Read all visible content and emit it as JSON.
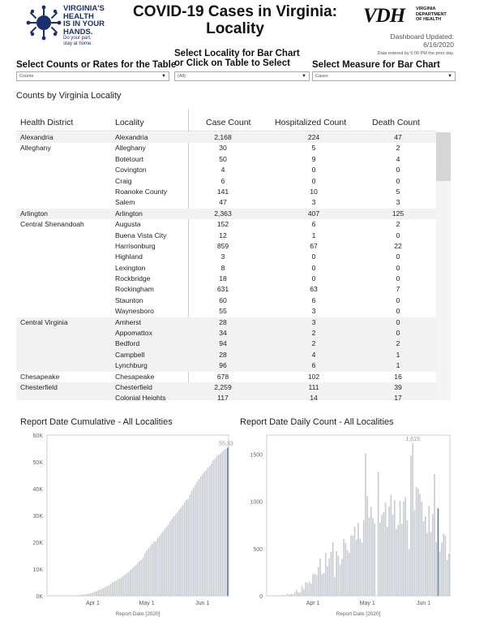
{
  "header": {
    "logo_lines": [
      "VIRGINIA'S",
      "HEALTH",
      "IS IN YOUR",
      "HANDS."
    ],
    "logo_sub": [
      "Do your part,",
      "stay at home."
    ],
    "title_line1": "COVID-19 Cases in Virginia:",
    "title_line2": "Locality",
    "vdh_mark": "VDH",
    "vdh_sub": [
      "VIRGINIA",
      "DEPARTMENT",
      "OF HEALTH"
    ],
    "updated_label": "Dashboard Updated:",
    "updated_date": "6/16/2020",
    "updated_note": "Data entered by 5:00 PM the prior day."
  },
  "filters": {
    "counts_label": "Select Counts or Rates for the Table",
    "counts_value": "Counts",
    "locality_label_1": "Select Locality for Bar Chart",
    "locality_label_2": "or Click on Table to Select",
    "locality_value": "(All)",
    "measure_label": "Select Measure for Bar Chart",
    "measure_value": "Cases",
    "dropdown_arrow": "▼"
  },
  "table": {
    "title": "Counts by Virginia Locality",
    "columns": [
      "Health District",
      "Locality",
      "Case Count",
      "Hospitalized Count",
      "Death Count"
    ],
    "rows": [
      [
        "Alexandria",
        "Alexandria",
        "2,168",
        "224",
        "47"
      ],
      [
        "Alleghany",
        "Alleghany",
        "30",
        "5",
        "2"
      ],
      [
        "",
        "Botetourt",
        "50",
        "9",
        "4"
      ],
      [
        "",
        "Covington",
        "4",
        "0",
        "0"
      ],
      [
        "",
        "Craig",
        "6",
        "0",
        "0"
      ],
      [
        "",
        "Roanoke County",
        "141",
        "10",
        "5"
      ],
      [
        "",
        "Salem",
        "47",
        "3",
        "3"
      ],
      [
        "Arlington",
        "Arlington",
        "2,363",
        "407",
        "125"
      ],
      [
        "Central Shenandoah",
        "Augusta",
        "152",
        "6",
        "2"
      ],
      [
        "",
        "Buena Vista City",
        "12",
        "1",
        "0"
      ],
      [
        "",
        "Harrisonburg",
        "859",
        "67",
        "22"
      ],
      [
        "",
        "Highland",
        "3",
        "0",
        "0"
      ],
      [
        "",
        "Lexington",
        "8",
        "0",
        "0"
      ],
      [
        "",
        "Rockbridge",
        "18",
        "0",
        "0"
      ],
      [
        "",
        "Rockingham",
        "631",
        "63",
        "7"
      ],
      [
        "",
        "Staunton",
        "60",
        "6",
        "0"
      ],
      [
        "",
        "Waynesboro",
        "55",
        "3",
        "0"
      ],
      [
        "Central Virginia",
        "Amherst",
        "28",
        "3",
        "0"
      ],
      [
        "",
        "Appomattox",
        "34",
        "2",
        "0"
      ],
      [
        "",
        "Bedford",
        "94",
        "2",
        "2"
      ],
      [
        "",
        "Campbell",
        "28",
        "4",
        "1"
      ],
      [
        "",
        "Lynchburg",
        "96",
        "6",
        "1"
      ],
      [
        "Chesapeake",
        "Chesapeake",
        "678",
        "102",
        "16"
      ],
      [
        "Chesterfield",
        "Chesterfield",
        "2,259",
        "111",
        "39"
      ],
      [
        "",
        "Colonial Heights",
        "117",
        "14",
        "17"
      ]
    ]
  },
  "charts": {
    "cumulative_title": "Report Date Cumulative - All Localities",
    "daily_title": "Report Date Daily Count - All Localities",
    "x_label": "Report Date [2020]",
    "bar_color": "#c8ccd2",
    "highlight_color": "#6a7f95"
  },
  "chart_data": [
    {
      "type": "bar",
      "title": "Report Date Cumulative - All Localities",
      "xlabel": "Report Date [2020]",
      "ylabel": "",
      "x_ticks": [
        "Apr 1",
        "May 1",
        "Jun 1"
      ],
      "y_ticks": [
        "0K",
        "10K",
        "20K",
        "30K",
        "40K",
        "50K",
        "60K"
      ],
      "ylim": [
        0,
        60000
      ],
      "start_date": "2020-03-07",
      "values": [
        2,
        3,
        3,
        3,
        9,
        12,
        17,
        23,
        30,
        41,
        45,
        67,
        77,
        99,
        114,
        152,
        219,
        254,
        291,
        391,
        460,
        604,
        739,
        890,
        1020,
        1250,
        1484,
        1706,
        2012,
        2407,
        2637,
        2878,
        3333,
        3645,
        4042,
        4509,
        5077,
        5274,
        5747,
        6171,
        6500,
        6889,
        7491,
        8053,
        8537,
        8990,
        9630,
        10266,
        10998,
        11594,
        12366,
        12970,
        13535,
        14339,
        15846,
        16901,
        17731,
        18671,
        19492,
        20256,
        20257,
        21570,
        22342,
        23196,
        24081,
        25070,
        25800,
        26746,
        27813,
        28672,
        29683,
        30388,
        31140,
        32145,
        32908,
        33908,
        34950,
        35749,
        36244,
        37727,
        39342,
        40249,
        41401,
        42533,
        43611,
        44607,
        45398,
        46239,
        46905,
        47856,
        48532,
        49397,
        50681,
        51251,
        52177,
        52647,
        53211,
        53869,
        54506,
        54886,
        55331
      ],
      "highlight_label": "55,331"
    },
    {
      "type": "bar",
      "title": "Report Date Daily Count - All Localities",
      "xlabel": "Report Date [2020]",
      "ylabel": "",
      "x_ticks": [
        "Apr 1",
        "May 1",
        "Jun 1"
      ],
      "y_ticks": [
        "0",
        "500",
        "1000",
        "1500"
      ],
      "ylim": [
        0,
        1700
      ],
      "start_date": "2020-03-07",
      "values": [
        2,
        1,
        0,
        0,
        6,
        3,
        5,
        6,
        7,
        11,
        4,
        22,
        10,
        22,
        15,
        38,
        67,
        35,
        37,
        100,
        69,
        144,
        135,
        151,
        130,
        230,
        234,
        222,
        306,
        395,
        230,
        241,
        455,
        312,
        397,
        467,
        568,
        197,
        473,
        424,
        329,
        389,
        602,
        562,
        484,
        453,
        640,
        636,
        732,
        596,
        772,
        604,
        565,
        804,
        1507,
        1055,
        830,
        940,
        821,
        764,
        0,
        1313,
        772,
        854,
        885,
        989,
        730,
        946,
        1067,
        859,
        1011,
        705,
        752,
        1005,
        763,
        1000,
        1042,
        799,
        495,
        1483,
        1615,
        907,
        1152,
        1132,
        1078,
        996,
        791,
        841,
        666,
        951,
        676,
        865,
        1284,
        570,
        926,
        470,
        564,
        658,
        637,
        380,
        445
      ],
      "highlight_label": "1,615"
    }
  ]
}
